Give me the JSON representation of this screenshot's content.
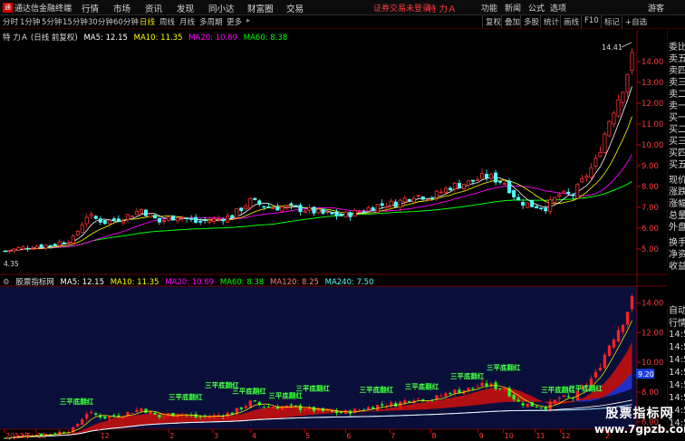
{
  "menubar": {
    "app_title": "通达信金融终端",
    "items": [
      "行情",
      "市场",
      "资讯",
      "发现",
      "同小达",
      "财富圈",
      "交易"
    ],
    "login_status": "证券交易未登录",
    "stock_name": "特 力Ａ",
    "right_items": [
      "功能",
      "新闻",
      "公式",
      "选项",
      "游客"
    ]
  },
  "toolbar": {
    "periods": [
      "分时",
      "1分钟",
      "5分钟",
      "15分钟",
      "30分钟",
      "60分钟",
      "日线",
      "周线",
      "月线",
      "多周期",
      "更多"
    ],
    "active_period": "日线",
    "right_buttons": [
      "复权",
      "叠加",
      "多股",
      "统计",
      "画线",
      "F10",
      "标记",
      "+自选"
    ]
  },
  "main_legend": {
    "title": "特 力Ａ (日线 前复权)",
    "ma5": "MA5: 12.15",
    "ma10": "MA10: 11.35",
    "ma20": "MA20: 10.69",
    "ma60": "MA60: 8.38"
  },
  "indicator_legend": {
    "title": "股票指标网",
    "ma5": "MA5: 12.15",
    "ma10": "MA10: 11.35",
    "ma20": "MA20: 10.69",
    "ma60": "MA60: 8.38",
    "ma120": "MA120: 8.25",
    "ma240": "MA240: 7.50"
  },
  "quote_panel": [
    "委比",
    "卖五",
    "卖四",
    "卖三",
    "卖二",
    "卖一",
    "买一",
    "买二",
    "买三",
    "买四",
    "买五",
    "现价",
    "涨跌",
    "涨幅",
    "总量",
    "外盘",
    "换手",
    "净资",
    "收益"
  ],
  "quote_panel2": [
    "自动",
    "行情",
    "14:5",
    "14:5",
    "14:5",
    "14:5",
    "14:5",
    "14:5",
    "14:5",
    "14:5"
  ],
  "l_badge": "L",
  "colors": {
    "up": "#ff3232",
    "down": "#54ffff",
    "ma5": "#ffffff",
    "ma10": "#ffff00",
    "ma20": "#ff00ff",
    "ma60": "#00ff00",
    "ma240": "#3c9cff"
  },
  "chart_data": [
    {
      "type": "candlestick",
      "title": "特 力Ａ (日线 前复权)",
      "ylim": [
        4.0,
        15.0
      ],
      "y_ticks": [
        5.0,
        6.0,
        7.0,
        8.0,
        9.0,
        10.0,
        11.0,
        12.0,
        13.0,
        14.0
      ],
      "y_tick_labels": [
        "5.00",
        "6.00",
        "7.00",
        "8.00",
        "9.00",
        "10.00",
        "11.00",
        "12.00",
        "13.00",
        "14.00"
      ],
      "bottom_label": "4.35",
      "high_label": "14.41",
      "series": [
        {
          "name": "MA5",
          "value": 12.15
        },
        {
          "name": "MA10",
          "value": 11.35
        },
        {
          "name": "MA20",
          "value": 10.69
        },
        {
          "name": "MA60",
          "value": 8.38
        }
      ],
      "close_path": [
        [
          0,
          4.9
        ],
        [
          5,
          5.1
        ],
        [
          10,
          5.2
        ],
        [
          15,
          5.5
        ],
        [
          18,
          6.6
        ],
        [
          22,
          6.3
        ],
        [
          26,
          6.5
        ],
        [
          30,
          6.9
        ],
        [
          34,
          6.3
        ],
        [
          38,
          6.6
        ],
        [
          42,
          6.3
        ],
        [
          46,
          6.4
        ],
        [
          50,
          6.6
        ],
        [
          54,
          7.3
        ],
        [
          58,
          7.0
        ],
        [
          62,
          7.0
        ],
        [
          66,
          6.9
        ],
        [
          70,
          6.7
        ],
        [
          74,
          6.6
        ],
        [
          78,
          6.8
        ],
        [
          82,
          7.1
        ],
        [
          86,
          7.2
        ],
        [
          90,
          7.6
        ],
        [
          94,
          7.5
        ],
        [
          98,
          8.0
        ],
        [
          102,
          8.2
        ],
        [
          106,
          8.5
        ],
        [
          110,
          8.2
        ],
        [
          113,
          7.3
        ],
        [
          116,
          7.1
        ],
        [
          119,
          7.0
        ],
        [
          122,
          7.6
        ],
        [
          125,
          7.6
        ],
        [
          130,
          9.2
        ],
        [
          133,
          11.2
        ],
        [
          136,
          12.8
        ],
        [
          138,
          14.2
        ]
      ],
      "n_bars": 139
    },
    {
      "type": "line",
      "title": "股票指标网",
      "ylim": [
        5.5,
        15.0
      ],
      "y_ticks": [
        6.0,
        8.0,
        10.0,
        12.0,
        14.0
      ],
      "y_tick_labels": [
        "6.00",
        "8.00",
        "10.00",
        "12.00",
        "14.00"
      ],
      "value_label": "9.20",
      "annotation": "三平底翻红",
      "series": [
        {
          "name": "MA5",
          "value": 12.15
        },
        {
          "name": "MA10",
          "value": 11.35
        },
        {
          "name": "MA20",
          "value": 10.69
        },
        {
          "name": "MA60",
          "value": 8.38
        },
        {
          "name": "MA120",
          "value": 8.25
        },
        {
          "name": "MA240",
          "value": 7.5
        }
      ],
      "x_tick_labels": [
        "2013年",
        "11",
        "12",
        "2",
        "3",
        "4",
        "5",
        "6",
        "7",
        "8",
        "9",
        "10",
        "11",
        "12",
        "2"
      ]
    }
  ],
  "watermark": {
    "line1": "股票指标网",
    "line2": "www.7gpzb.com"
  }
}
